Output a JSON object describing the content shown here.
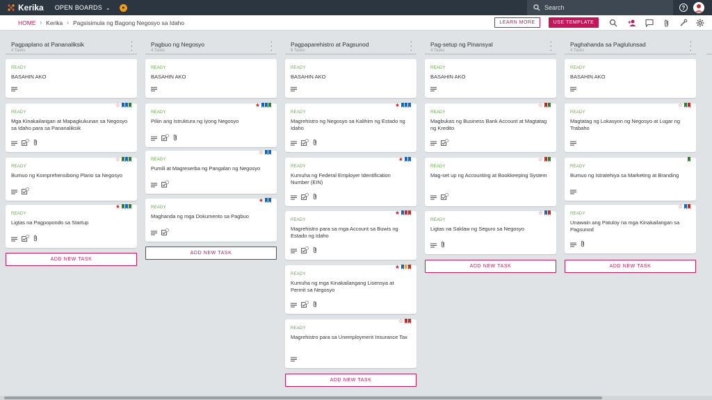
{
  "topbar": {
    "logo_text": "Kerika",
    "open_boards": "OPEN BOARDS",
    "search_placeholder": "Search",
    "help": "?"
  },
  "breadcrumb": [
    "HOME",
    "Kerika",
    "Pagsisimula ng Bagong Negosyo sa Idaho"
  ],
  "actions": {
    "learn_more": "LEARN MORE",
    "use_template": "USE TEMPLATE"
  },
  "toolbar_icons": [
    "search-icon",
    "add-person-icon",
    "chat-icon",
    "attachment-icon",
    "tools-icon",
    "settings-icon"
  ],
  "colors": {
    "accent": "#c2185b",
    "ready": "#6aa84f",
    "topbar": "#2b3640"
  },
  "add_task_label": "ADD NEW TASK",
  "columns": [
    {
      "title": "Pagpaplano at Pananaliksik",
      "count": "4 Tasks",
      "cards": [
        {
          "status": "READY",
          "title": "BASAHIN AKO",
          "icons": [
            "desc"
          ],
          "flags": []
        },
        {
          "status": "READY",
          "title": "Mga Kinakailangan at Mapagkukunan sa Negosyo sa Idaho para sa Pananaliksik",
          "icons": [
            "desc",
            "check",
            "attach"
          ],
          "flags": [
            "star-outline",
            "#1565c0",
            "#1565c0",
            "#2e7d32"
          ]
        },
        {
          "status": "READY",
          "title": "Bumuo ng Komprehensibong Plano sa Negosyo",
          "icons": [
            "desc",
            "check"
          ],
          "flags": [
            "star-outline",
            "#2e7d32",
            "#1565c0",
            "#2e7d32"
          ]
        },
        {
          "status": "READY",
          "title": "Ligtas na Pagpopondo sa Startup",
          "icons": [
            "desc",
            "check",
            "attach"
          ],
          "flags": [
            "star-filled",
            "#2e7d32",
            "#1565c0",
            "#2e7d32"
          ]
        }
      ]
    },
    {
      "title": "Pagbuo ng Negosyo",
      "count": "4 Tasks",
      "cards": [
        {
          "status": "READY",
          "title": "BASAHIN AKO",
          "icons": [
            "desc"
          ],
          "flags": []
        },
        {
          "status": "READY",
          "title": "Piliin ang Istruktura ng Iyong Negosyo",
          "icons": [
            "desc",
            "check",
            "attach"
          ],
          "flags": [
            "star-filled",
            "#1565c0",
            "#1565c0",
            "#2e7d32"
          ]
        },
        {
          "status": "READY",
          "title": "Pumili at Magreserba ng Pangalan ng Negosyo",
          "icons": [
            "desc",
            "check"
          ],
          "flags": [
            "star-outline",
            "#1565c0",
            "#1565c0"
          ]
        },
        {
          "status": "READY",
          "title": "Maghanda ng mga Dokumento sa Pagbuo",
          "icons": [
            "desc",
            "check"
          ],
          "flags": [
            "star-filled",
            "#1565c0",
            "#1565c0"
          ]
        }
      ]
    },
    {
      "title": "Pagpaparehistro at Pagsunod",
      "count": "6 Tasks",
      "cards": [
        {
          "status": "READY",
          "title": "BASAHIN AKO",
          "icons": [
            "desc"
          ],
          "flags": []
        },
        {
          "status": "READY",
          "title": "Magrehistro ng Negosyo sa Kalihim ng Estado ng Idaho",
          "icons": [
            "desc",
            "check",
            "attach"
          ],
          "flags": [
            "star-filled",
            "#1565c0",
            "#1565c0",
            "#1565c0"
          ]
        },
        {
          "status": "READY",
          "title": "Kumuha ng Federal Employer Identification Number (EIN)",
          "icons": [
            "desc",
            "check",
            "attach"
          ],
          "flags": [
            "star-filled",
            "#1565c0",
            "#1565c0"
          ]
        },
        {
          "status": "READY",
          "title": "Magrehistro para sa mga Account sa Buwis ng Estado ng Idaho",
          "icons": [
            "desc",
            "check",
            "attach"
          ],
          "flags": [
            "star-filled",
            "#1565c0",
            "#c62828",
            "#c62828"
          ]
        },
        {
          "status": "READY",
          "title": "Kumuha ng mga Kinakailangang Lisensya at Permit sa Negosyo",
          "icons": [
            "desc",
            "check",
            "attach"
          ],
          "flags": [
            "star-filled",
            "#1565c0",
            "#f9a825",
            "#c62828"
          ]
        },
        {
          "status": "READY",
          "title": "Magrehistro para sa Unemployment Insurance Tax",
          "icons": [
            "desc"
          ],
          "flags": [
            "star-outline",
            "#c62828",
            "#c62828"
          ]
        }
      ]
    },
    {
      "title": "Pag-setup ng Pinansyal",
      "count": "4 Tasks",
      "cards": [
        {
          "status": "READY",
          "title": "BASAHIN AKO",
          "icons": [
            "desc"
          ],
          "flags": []
        },
        {
          "status": "READY",
          "title": "Magbukas ng Business Bank Account at Magtatag ng Kredito",
          "icons": [
            "desc",
            "check"
          ],
          "flags": [
            "star-outline",
            "#c62828",
            "#2e7d32"
          ]
        },
        {
          "status": "READY",
          "title": "Mag-set up ng Accounting at Bookkeeping System",
          "icons": [
            "desc",
            "check"
          ],
          "flags": [
            "star-outline",
            "#c62828",
            "#2e7d32"
          ]
        },
        {
          "status": "READY",
          "title": "Ligtas na Saklaw ng Seguro sa Negosyo",
          "icons": [
            "desc",
            "attach"
          ],
          "flags": [
            "star-outline",
            "#1565c0",
            "#c62828"
          ]
        }
      ]
    },
    {
      "title": "Paghahanda sa Paglulunsad",
      "count": "4 Tasks",
      "cards": [
        {
          "status": "READY",
          "title": "BASAHIN AKO",
          "icons": [
            "desc"
          ],
          "flags": []
        },
        {
          "status": "READY",
          "title": "Magtatag ng Lokasyon ng Negosyo at Lugar ng Trabaho",
          "icons": [
            "desc"
          ],
          "flags": [
            "star-outline",
            "#2e7d32",
            "#c62828"
          ]
        },
        {
          "status": "READY",
          "title": "Bumuo ng Istratehiya sa Marketing at Branding",
          "icons": [
            "desc"
          ],
          "flags": [
            "#2e7d32"
          ]
        },
        {
          "status": "READY",
          "title": "Unawain ang Patuloy na mga Kinakailangan sa Pagsunod",
          "icons": [
            "desc",
            "attach"
          ],
          "flags": [
            "star-outline",
            "#1565c0",
            "#c62828"
          ]
        }
      ]
    }
  ]
}
